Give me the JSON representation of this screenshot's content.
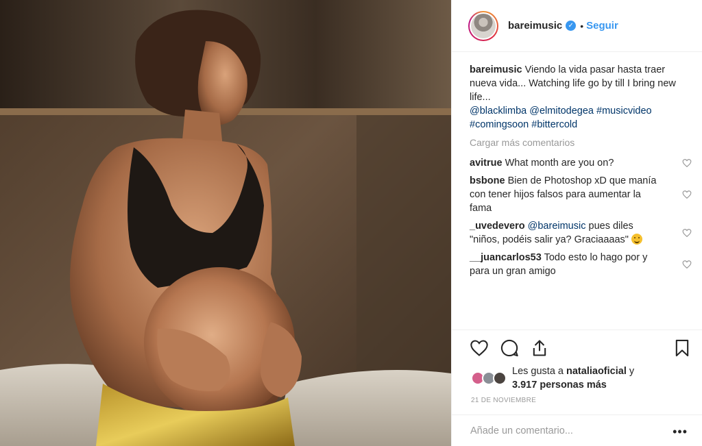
{
  "post": {
    "username": "bareimusic",
    "follow_label": "Seguir",
    "separator": "•",
    "caption_text": "Viendo la vida pasar hasta traer nueva vida... Watching life go by till I bring new life...",
    "caption_tags": [
      "@blacklimba",
      "@elmitodegea",
      "#musicvideo",
      "#comingsoon",
      "#bittercold"
    ],
    "load_more_label": "Cargar más comentarios",
    "comments": [
      {
        "user": "avitrue",
        "text": "What month are you on?"
      },
      {
        "user": "bsbone",
        "text": "Bien de Photoshop xD que manía con tener hijos falsos para aumentar la fama"
      },
      {
        "user": "_uvedevero",
        "mention": "@bareimusic",
        "text": "pues diles \"niños, podéis salir ya? Graciaaaas\""
      },
      {
        "user": "__juancarlos53",
        "text": "Todo esto lo hago por y para un gran amigo"
      }
    ],
    "likes": {
      "prefix": "Les gusta a",
      "user": "nataliaoficial",
      "conj": "y",
      "count_text": "3.917 personas más"
    },
    "date": "21 DE NOVIEMBRE",
    "add_comment_placeholder": "Añade un comentario...",
    "more_label": "•••"
  },
  "colors": {
    "accent": "#3897f0",
    "tag": "#003569",
    "muted": "#999999"
  }
}
